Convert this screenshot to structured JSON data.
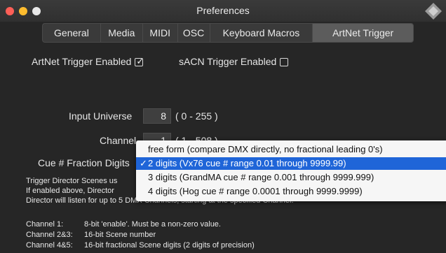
{
  "window": {
    "title": "Preferences"
  },
  "tabs": [
    {
      "label": "General"
    },
    {
      "label": "Media"
    },
    {
      "label": "MIDI"
    },
    {
      "label": "OSC"
    },
    {
      "label": "Keyboard Macros"
    },
    {
      "label": "ArtNet Trigger"
    }
  ],
  "artnet": {
    "label": "ArtNet Trigger Enabled",
    "checked": true,
    "check_glyph": "✓"
  },
  "sacn": {
    "label": "sACN Trigger Enabled",
    "checked": false
  },
  "input_universe": {
    "label": "Input Universe",
    "value": "8",
    "range": "( 0 - 255 )"
  },
  "channel": {
    "label": "Channel",
    "value": "1",
    "range": "( 1 - 508 )"
  },
  "cue_fraction": {
    "label": "Cue # Fraction Digits"
  },
  "description": {
    "line1": "Trigger Director Scenes us",
    "line2": "If enabled above, Director",
    "line3": "Director will listen for up to 5 DMX Channels, starting at the specified Channel."
  },
  "channel_info": [
    {
      "key": "Channel 1:",
      "value": "8-bit 'enable'.  Must be a non-zero value."
    },
    {
      "key": "Channel 2&3:",
      "value": "16-bit Scene number"
    },
    {
      "key": "Channel 4&5:",
      "value": "16-bit fractional Scene digits (2 digits of precision)"
    }
  ],
  "dropdown": {
    "items": [
      {
        "label": "free form (compare DMX directly, no fractional leading 0's)",
        "selected": false
      },
      {
        "label": "2 digits (Vx76 cue # range 0.01 through 9999.99)",
        "selected": true
      },
      {
        "label": "3 digits (GrandMA cue # range 0.001 through 9999.999)",
        "selected": false
      },
      {
        "label": "4 digits (Hog cue # range 0.0001 through 9999.9999)",
        "selected": false
      }
    ],
    "selected_mark": "✓"
  }
}
